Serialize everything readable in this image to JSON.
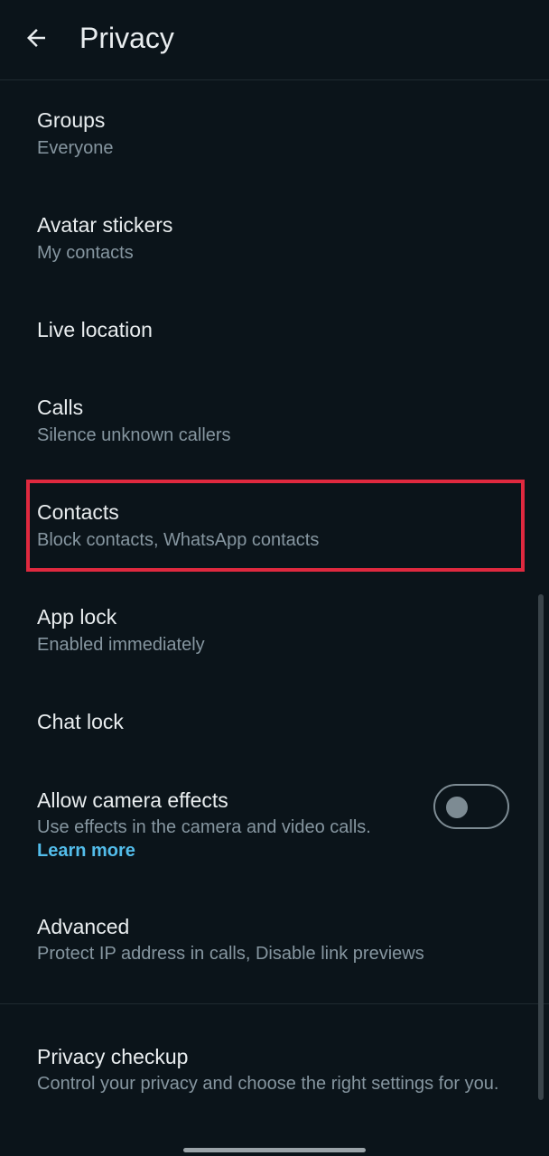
{
  "header": {
    "title": "Privacy",
    "back_icon": "arrow-left-icon"
  },
  "items": [
    {
      "title": "Groups",
      "subtitle": "Everyone"
    },
    {
      "title": "Avatar stickers",
      "subtitle": "My contacts"
    },
    {
      "title": "Live location",
      "subtitle": ""
    },
    {
      "title": "Calls",
      "subtitle": "Silence unknown callers"
    },
    {
      "title": "Contacts",
      "subtitle": "Block contacts, WhatsApp contacts"
    },
    {
      "title": "App lock",
      "subtitle": "Enabled immediately"
    },
    {
      "title": "Chat lock",
      "subtitle": ""
    },
    {
      "title": "Allow camera effects",
      "subtitle": "Use effects in the camera and video calls.",
      "link": "Learn more",
      "toggle_on": false
    },
    {
      "title": "Advanced",
      "subtitle": "Protect IP address in calls, Disable link previews"
    },
    {
      "title": "Privacy checkup",
      "subtitle": "Control your privacy and choose the right settings for you."
    }
  ],
  "colors": {
    "background": "#0b141a",
    "primary_text": "#e9edef",
    "secondary_text": "#8696a0",
    "link": "#53bdeb",
    "highlight_border": "#e0293f"
  }
}
